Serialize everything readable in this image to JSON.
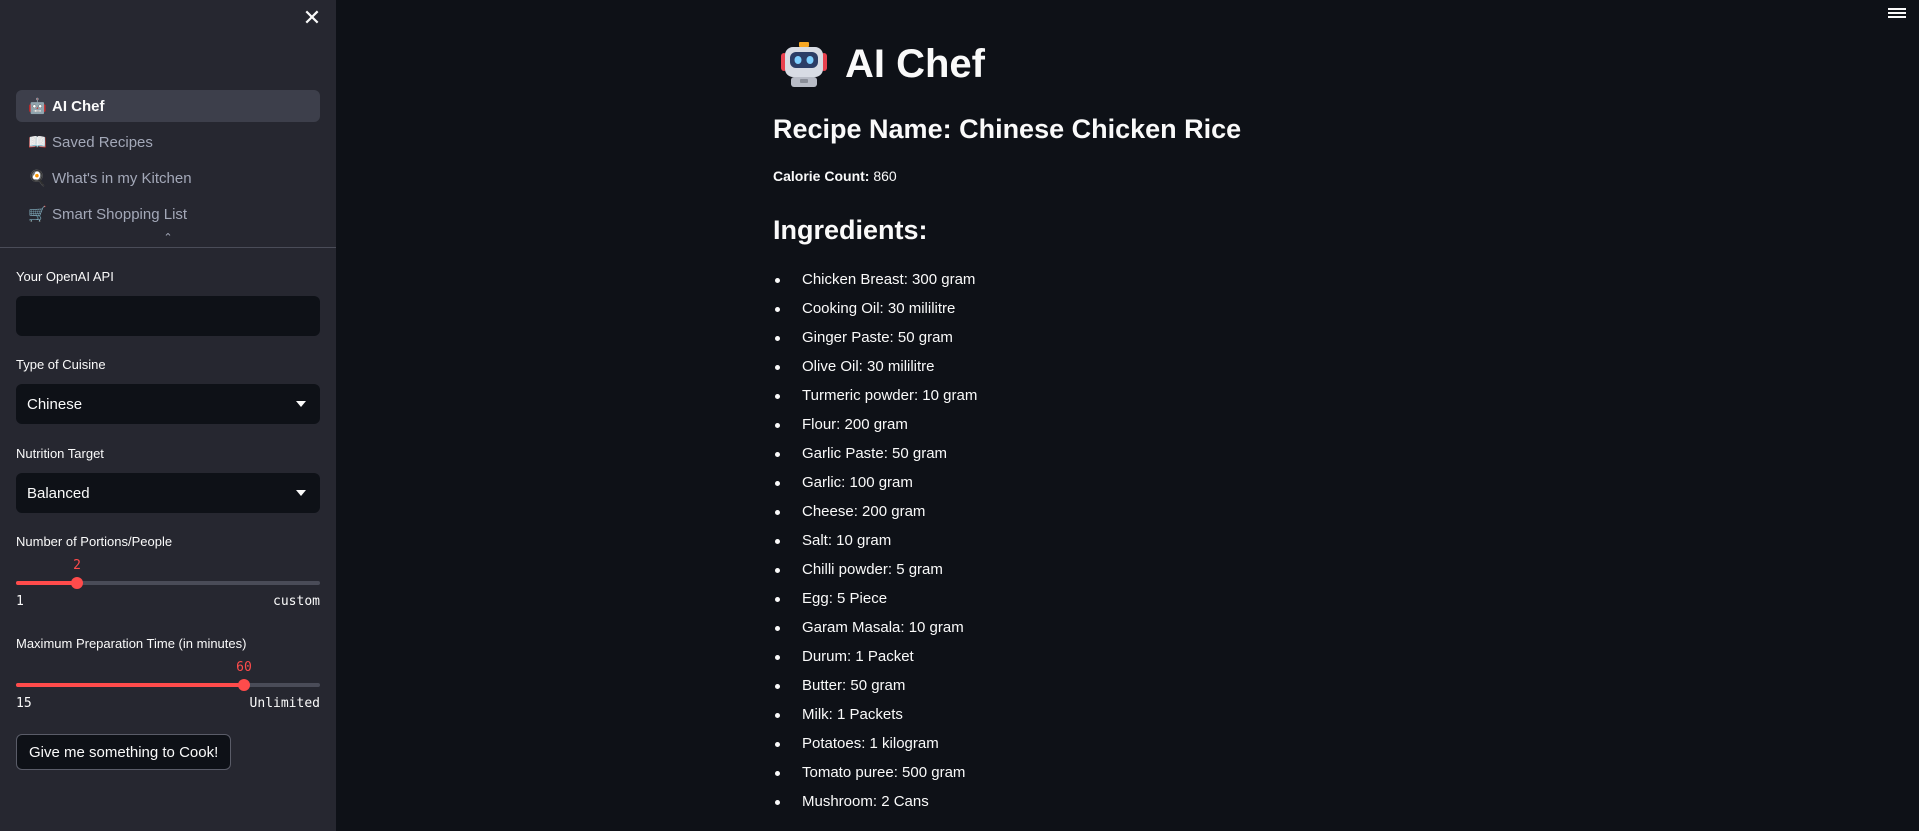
{
  "sidebar": {
    "nav": [
      {
        "icon": "🤖",
        "label": "AI Chef",
        "active": true
      },
      {
        "icon": "📖",
        "label": "Saved Recipes",
        "active": false
      },
      {
        "icon": "🍳",
        "label": "What's in my Kitchen",
        "active": false
      },
      {
        "icon": "🛒",
        "label": "Smart Shopping List",
        "active": false
      }
    ],
    "api_label": "Your OpenAI API",
    "api_value": "",
    "cuisine_label": "Type of Cuisine",
    "cuisine_value": "Chinese",
    "nutrition_label": "Nutrition Target",
    "nutrition_value": "Balanced",
    "portions": {
      "label": "Number of Portions/People",
      "value": "2",
      "min": "1",
      "max": "custom",
      "fraction": 0.2
    },
    "prep_time": {
      "label": "Maximum Preparation Time (in minutes)",
      "value": "60",
      "min": "15",
      "max": "Unlimited",
      "fraction": 0.75
    },
    "cook_button": "Give me something to Cook!"
  },
  "main": {
    "title": "AI Chef",
    "recipe_name": "Recipe Name: Chinese Chicken Rice",
    "calorie_label": "Calorie Count:",
    "calorie_value": "860",
    "ingredients_heading": "Ingredients:",
    "ingredients": [
      "Chicken Breast: 300 gram",
      "Cooking Oil: 30 mililitre",
      "Ginger Paste: 50 gram",
      "Olive Oil: 30 mililitre",
      "Turmeric powder: 10 gram",
      "Flour: 200 gram",
      "Garlic Paste: 50 gram",
      "Garlic: 100 gram",
      "Cheese: 200 gram",
      "Salt: 10 gram",
      "Chilli powder: 5 gram",
      "Egg: 5 Piece",
      "Garam Masala: 10 gram",
      "Durum: 1 Packet",
      "Butter: 50 gram",
      "Milk: 1 Packets",
      "Potatoes: 1 kilogram",
      "Tomato puree: 500 gram",
      "Mushroom: 2 Cans"
    ]
  },
  "colors": {
    "accent": "#ff4b4b",
    "background": "#0e1117",
    "sidebar": "#262730"
  }
}
